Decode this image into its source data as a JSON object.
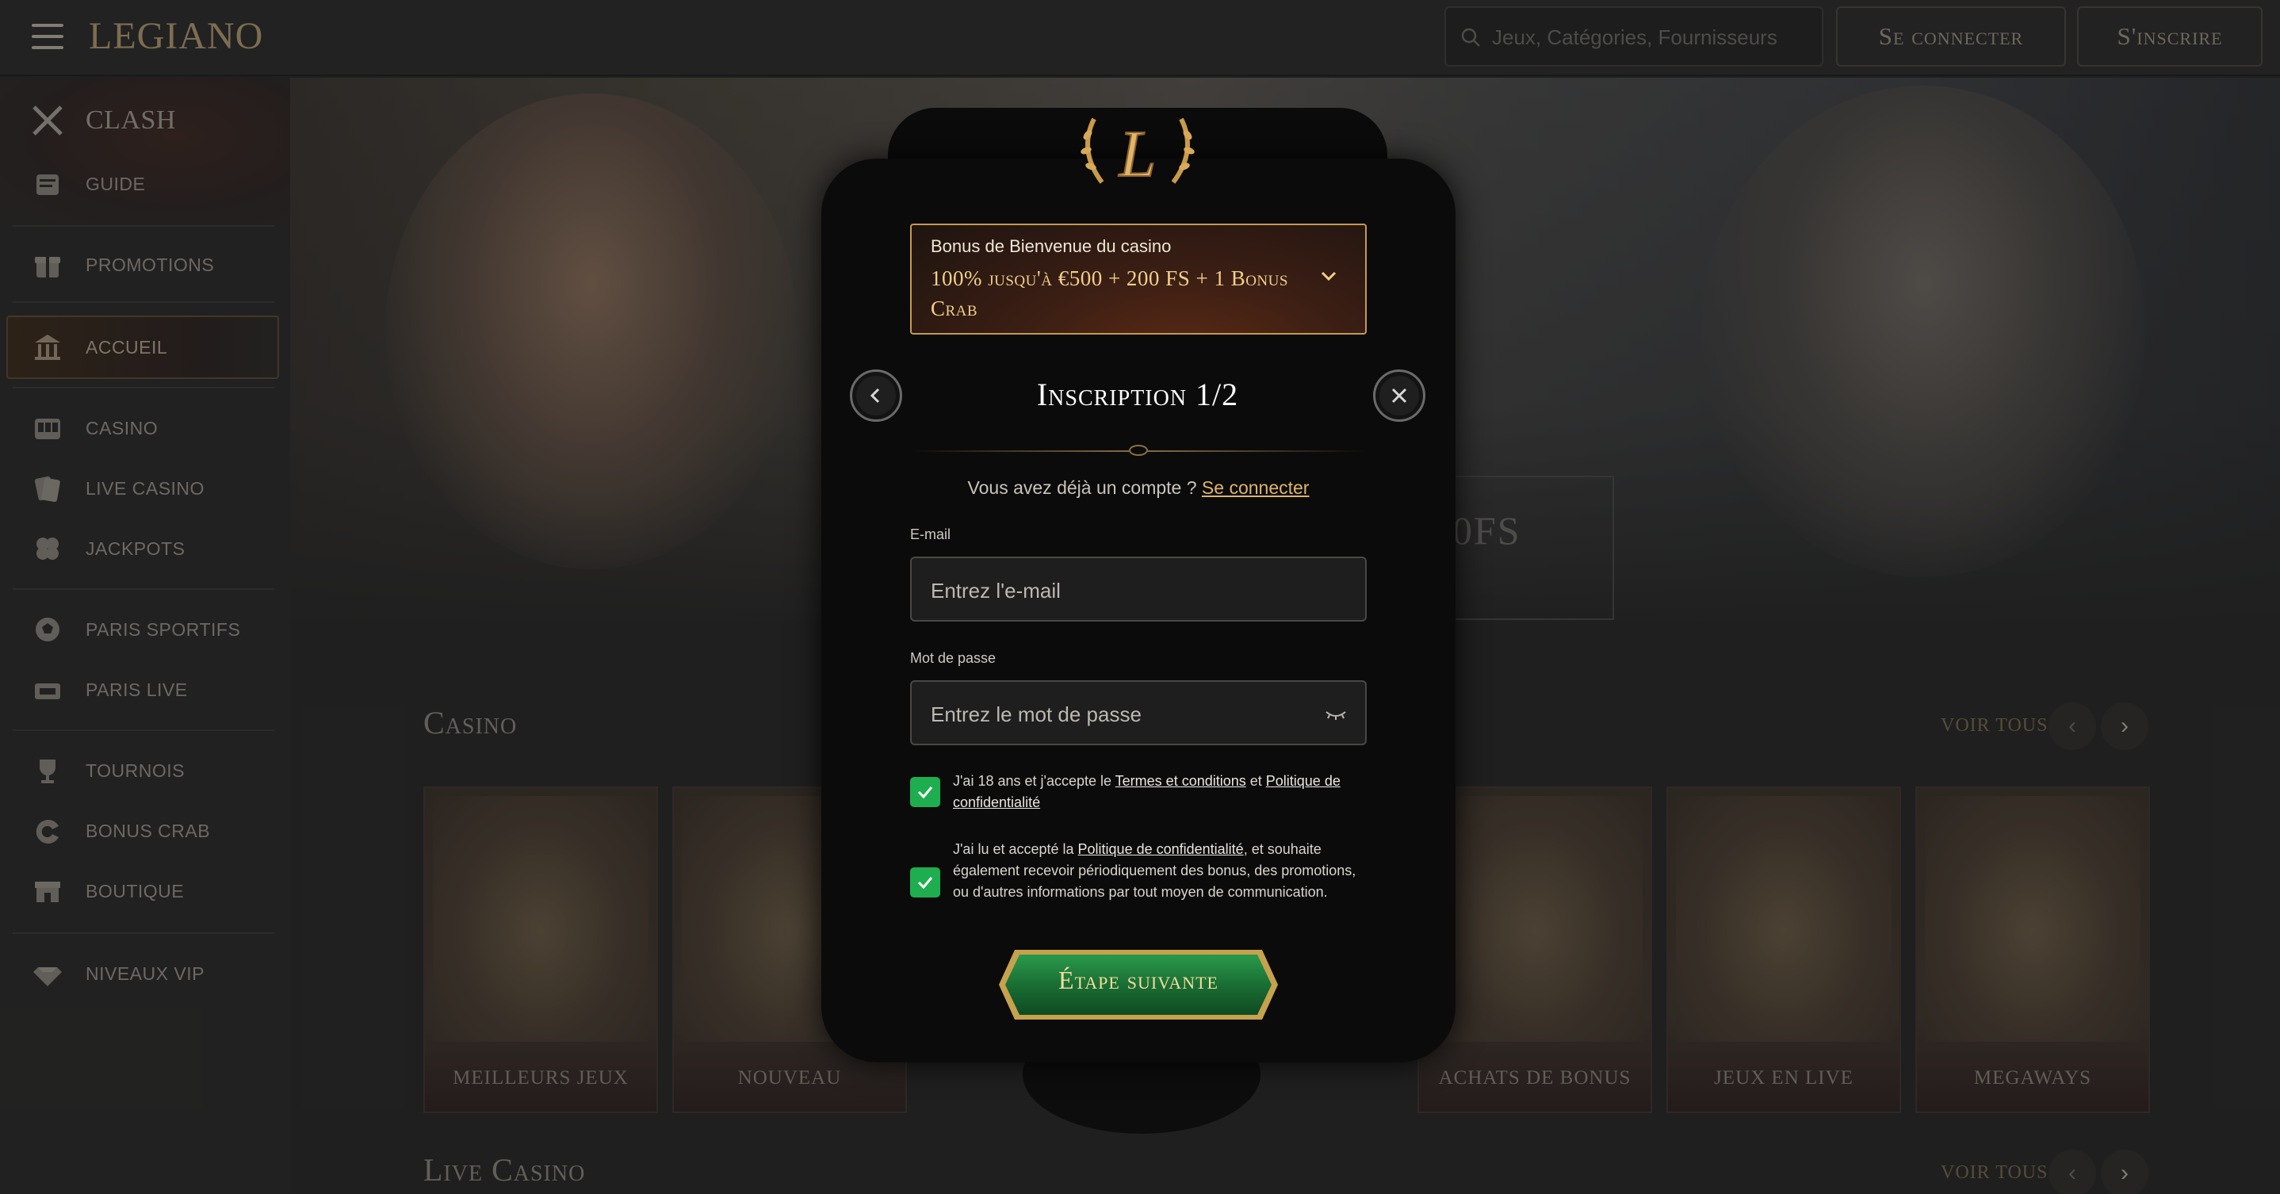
{
  "header": {
    "logo": "LEGIANO",
    "search_placeholder": "Jeux, Catégories, Fournisseurs",
    "login_label": "Se connecter",
    "register_label": "S'inscrire"
  },
  "sidebar": {
    "items": [
      {
        "label": "CLASH"
      },
      {
        "label": "GUIDE"
      },
      {
        "label": "PROMOTIONS"
      },
      {
        "label": "ACCUEIL"
      },
      {
        "label": "CASINO"
      },
      {
        "label": "LIVE CASINO"
      },
      {
        "label": "JACKPOTS"
      },
      {
        "label": "PARIS SPORTIFS"
      },
      {
        "label": "PARIS LIVE"
      },
      {
        "label": "TOURNOIS"
      },
      {
        "label": "BONUS CRAB"
      },
      {
        "label": "BOUTIQUE"
      },
      {
        "label": "NIVEAUX VIP"
      }
    ]
  },
  "hero": {
    "partial_text": "0FS"
  },
  "sections": {
    "casino": {
      "title": "Casino",
      "see_all": "VOIR TOUS"
    },
    "live_casino": {
      "title": "Live Casino",
      "see_all": "VOIR TOUS"
    }
  },
  "cards": [
    {
      "name": "MEILLEURS JEUX"
    },
    {
      "name": "NOUVEAU"
    },
    {
      "name": "ACHATS DE BONUS"
    },
    {
      "name": "JEUX EN LIVE"
    },
    {
      "name": "MEGAWAYS"
    }
  ],
  "modal": {
    "bonus_caption": "Bonus de Bienvenue du casino",
    "bonus_offer": "100% jusqu'à €500 + 200 FS + 1 Bonus Crab",
    "title": "Inscription 1/2",
    "have_account": "Vous avez déjà un compte ?",
    "login_link": "Se connecter",
    "email_label": "E-mail",
    "email_placeholder": "Entrez l'e-mail",
    "password_label": "Mot de passe",
    "password_placeholder": "Entrez le mot de passe",
    "terms": {
      "checked": true,
      "prefix": "J'ai 18 ans et j'accepte le ",
      "link1": "Termes et conditions",
      "mid": " et ",
      "link2": "Politique de confidentialité"
    },
    "marketing": {
      "checked": true,
      "prefix": "J'ai lu et accepté la ",
      "link": "Politique de confidentialité",
      "suffix": ", et souhaite également recevoir périodiquement des bonus, des promotions, ou d'autres informations par tout moyen de communication."
    },
    "next_button": "Étape suivante"
  },
  "colors": {
    "accent_gold": "#c69a4e",
    "link_gold": "#e0b46a",
    "check_green": "#1fae4f",
    "button_green": "#1e7d3c"
  }
}
